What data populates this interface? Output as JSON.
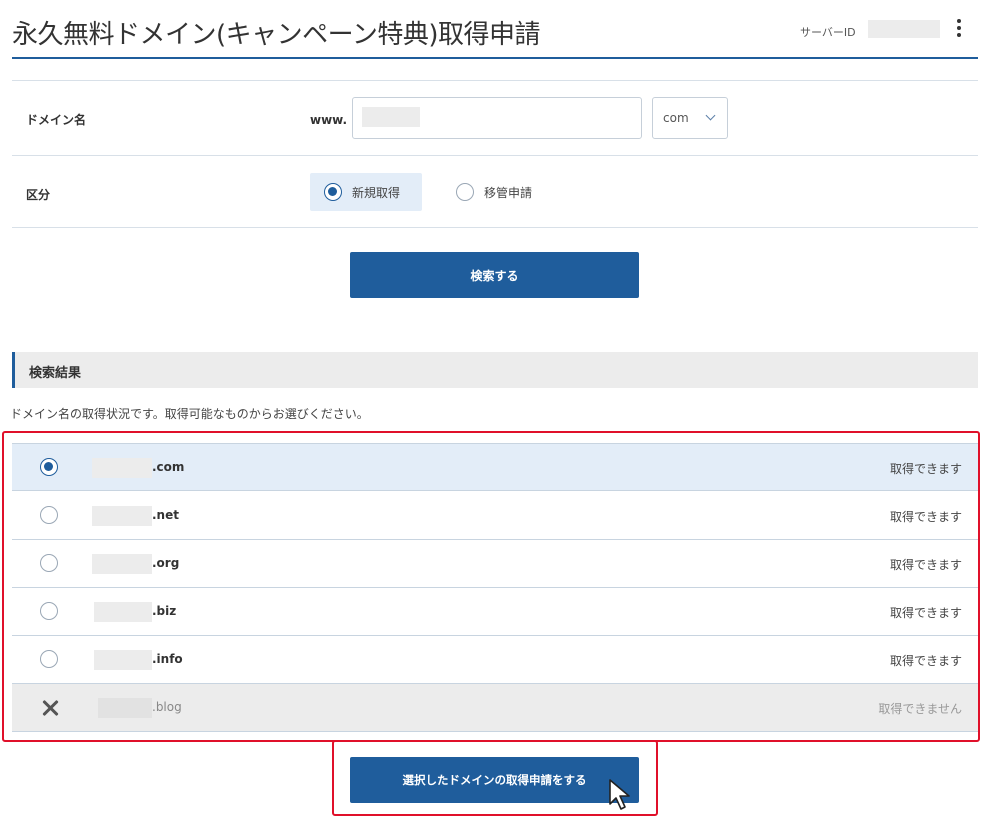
{
  "header": {
    "title": "永久無料ドメイン(キャンペーン特典)取得申請",
    "server_id_label": "サーバーID"
  },
  "form": {
    "domain_label": "ドメイン名",
    "www_prefix": "www.",
    "domain_value": "",
    "tld_value": "com",
    "type_label": "区分",
    "options": [
      {
        "label": "新規取得",
        "selected": true
      },
      {
        "label": "移管申請",
        "selected": false
      }
    ],
    "search_button": "検索する"
  },
  "results": {
    "section_title": "検索結果",
    "note": "ドメイン名の取得状況です。取得可能なものからお選びください。",
    "rows": [
      {
        "tld": ".com",
        "status": "取得できます",
        "available": true,
        "selected": true
      },
      {
        "tld": ".net",
        "status": "取得できます",
        "available": true,
        "selected": false
      },
      {
        "tld": ".org",
        "status": "取得できます",
        "available": true,
        "selected": false
      },
      {
        "tld": ".biz",
        "status": "取得できます",
        "available": true,
        "selected": false
      },
      {
        "tld": ".info",
        "status": "取得できます",
        "available": true,
        "selected": false
      },
      {
        "tld": ".blog",
        "status": "取得できません",
        "available": false,
        "selected": false
      }
    ]
  },
  "submit_button": "選択したドメインの取得申請をする",
  "colors": {
    "primary": "#1f5d9c",
    "highlight_border": "#e0102a",
    "selected_bg": "#e3edf8",
    "disabled_bg": "#ececec"
  },
  "icons": {
    "menu": "kebab-menu-icon",
    "chevron": "chevron-down-icon",
    "unavailable": "x-icon",
    "cursor": "mouse-pointer-icon"
  }
}
